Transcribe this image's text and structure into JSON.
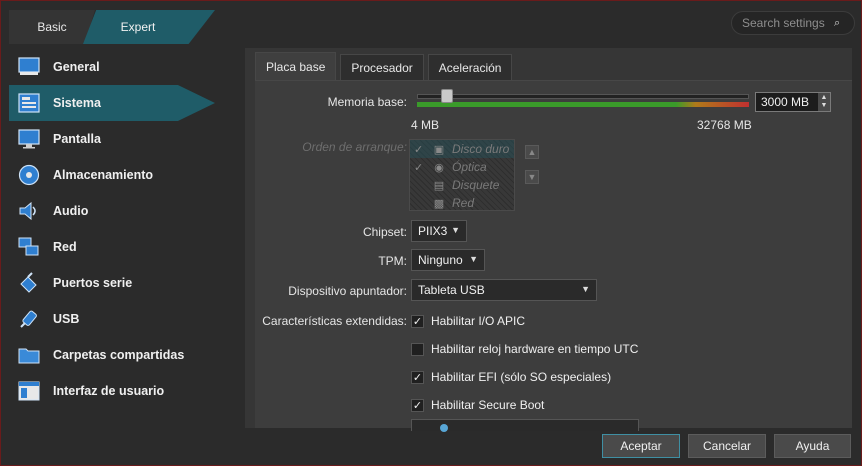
{
  "mode_tabs": {
    "basic": "Basic",
    "expert": "Expert"
  },
  "search": {
    "placeholder": "Search settings"
  },
  "sidebar": {
    "items": [
      {
        "label": "General",
        "icon": "monitor-general-icon"
      },
      {
        "label": "Sistema",
        "icon": "motherboard-icon",
        "active": true
      },
      {
        "label": "Pantalla",
        "icon": "display-icon"
      },
      {
        "label": "Almacenamiento",
        "icon": "disk-icon"
      },
      {
        "label": "Audio",
        "icon": "speaker-icon"
      },
      {
        "label": "Red",
        "icon": "network-icon"
      },
      {
        "label": "Puertos serie",
        "icon": "serial-port-icon"
      },
      {
        "label": "USB",
        "icon": "usb-icon"
      },
      {
        "label": "Carpetas compartidas",
        "icon": "shared-folder-icon"
      },
      {
        "label": "Interfaz de usuario",
        "icon": "user-interface-icon"
      }
    ]
  },
  "tabs": [
    {
      "label": "Placa base",
      "active": true
    },
    {
      "label": "Procesador"
    },
    {
      "label": "Aceleración"
    }
  ],
  "motherboard": {
    "memory_label": "Memoria base:",
    "memory_value": "3000 MB",
    "memory_min": "4 MB",
    "memory_max": "32768 MB",
    "memory_fraction": 0.09,
    "boot_order_label": "Orden de arranque:",
    "boot_items": [
      {
        "label": "Disco duro",
        "checked": true
      },
      {
        "label": "Óptica",
        "checked": true
      },
      {
        "label": "Disquete",
        "checked": false
      },
      {
        "label": "Red",
        "checked": false
      }
    ],
    "chipset_label": "Chipset:",
    "chipset_value": "PIIX3",
    "tpm_label": "TPM:",
    "tpm_value": "Ninguno",
    "pointer_label": "Dispositivo apuntador:",
    "pointer_value": "Tableta USB",
    "ext_label": "Características extendidas:",
    "features": [
      {
        "label": "Habilitar I/O APIC",
        "checked": true
      },
      {
        "label": "Habilitar reloj hardware en tiempo UTC",
        "checked": false
      },
      {
        "label": "Habilitar EFI (sólo SO especiales)",
        "checked": true
      },
      {
        "label": "Habilitar Secure Boot",
        "checked": true
      }
    ]
  },
  "footer": {
    "accept": "Aceptar",
    "cancel": "Cancelar",
    "help": "Ayuda"
  },
  "colors": {
    "accent": "#1f5c68",
    "background": "#2b2b2b",
    "panel": "#3d3d3d"
  }
}
